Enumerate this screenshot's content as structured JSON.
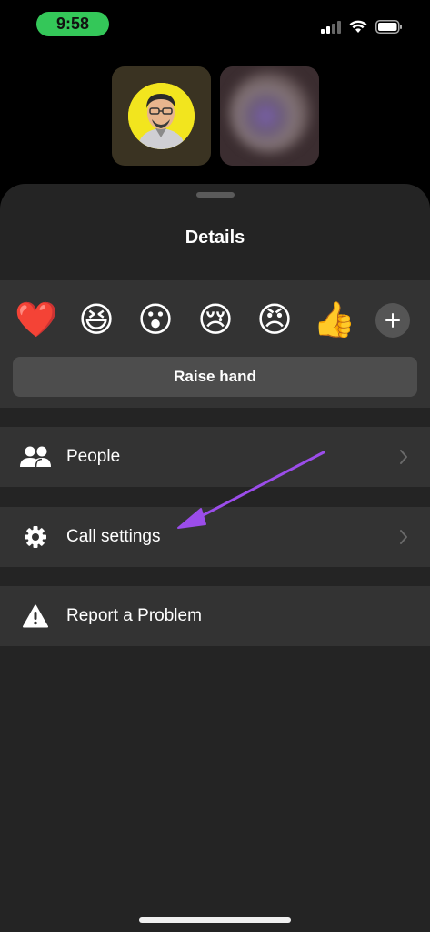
{
  "status_bar": {
    "time": "9:58",
    "icons": [
      "signal-icon",
      "wifi-icon",
      "battery-icon"
    ],
    "time_pill_color": "#34c759"
  },
  "participants": [
    {
      "name": "avatar-cartoon",
      "tile_color": "#3a3322",
      "avatar_bg": "#f2e51e"
    },
    {
      "name": "avatar-blurred",
      "tile_color": "#3b2d30"
    }
  ],
  "sheet": {
    "title": "Details",
    "reactions": [
      {
        "name": "heart",
        "glyph": "❤️"
      },
      {
        "name": "laughing",
        "glyph": "😆"
      },
      {
        "name": "surprised",
        "glyph": "😮"
      },
      {
        "name": "crying",
        "glyph": "😢"
      },
      {
        "name": "angry",
        "glyph": "😠"
      },
      {
        "name": "thumbs-up",
        "glyph": "👍"
      }
    ],
    "more_reactions_icon": "plus-icon",
    "raise_hand_label": "Raise hand",
    "menu": [
      {
        "label": "People",
        "icon": "people-icon",
        "has_chevron": true
      },
      {
        "label": "Call settings",
        "icon": "gear-icon",
        "has_chevron": true
      },
      {
        "label": "Report a Problem",
        "icon": "warning-icon",
        "has_chevron": false
      }
    ]
  },
  "annotation": {
    "type": "arrow",
    "color": "#9b4dea",
    "points_to": "Call settings"
  },
  "colors": {
    "background": "#000000",
    "sheet": "#242424",
    "panel": "#333333",
    "button": "#4d4d4d",
    "accent_arrow": "#9b4dea"
  }
}
